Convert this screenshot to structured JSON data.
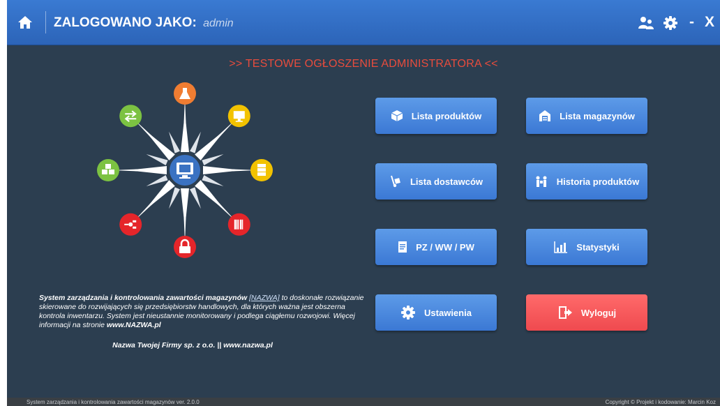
{
  "topbar": {
    "home_icon": "home-icon",
    "login_label": "ZALOGOWANO JAKO:",
    "username": "admin",
    "users_icon": "users-icon",
    "settings_icon": "gear-icon",
    "minimize_label": "-",
    "close_label": "X"
  },
  "announcement": ">> TESTOWE OGŁOSZENIE ADMINISTRATORA <<",
  "graphic": {
    "center_icon": "computer-icon",
    "nodes": [
      {
        "name": "flask-icon",
        "color": "#f07d32"
      },
      {
        "name": "monitor-icon",
        "color": "#f2c200"
      },
      {
        "name": "server-icon",
        "color": "#f2c200"
      },
      {
        "name": "barcode-icon",
        "color": "#e5252a"
      },
      {
        "name": "lock-icon",
        "color": "#e5252a"
      },
      {
        "name": "hierarchy-icon",
        "color": "#e5252a"
      },
      {
        "name": "boxes-icon",
        "color": "#7cc242"
      },
      {
        "name": "transfer-icon",
        "color": "#7cc242"
      }
    ]
  },
  "buttons": {
    "products": "Lista produktów",
    "warehouses": "Lista magazynów",
    "suppliers": "Lista dostawców",
    "history": "Historia produktów",
    "documents": "PZ / WW / PW",
    "stats": "Statystyki",
    "settings": "Ustawienia",
    "logout": "Wyloguj"
  },
  "description": {
    "bold_intro": "System zarządzania i kontrolowania zawartości magazynów",
    "name_link": "[NAZWA]",
    "text": "to doskonałe rozwiązanie skierowane do rozwijających się przedsiębiorstw handlowych, dla których ważna jest obszerna kontrola inwentarzu. System jest nieustannie monitorowany i podlega ciągłemu rozwojowi. Więcej informacji na stronie",
    "site": "www.NAZWA.pl",
    "company": "Nazwa Twojej Firmy sp. z o.o. || www.nazwa.pl"
  },
  "footer": {
    "version": "System zarządzania i kontrolowania zawartości magazynów ver. 2.0.0",
    "copyright": "Copyright © Projekt i kodowanie: Marcin Koz"
  },
  "colors": {
    "background": "#2c3e50",
    "topbar": "#3170c7",
    "button": "#4a88dd",
    "logout": "#f25a5d",
    "announcement": "#e84c3d"
  }
}
